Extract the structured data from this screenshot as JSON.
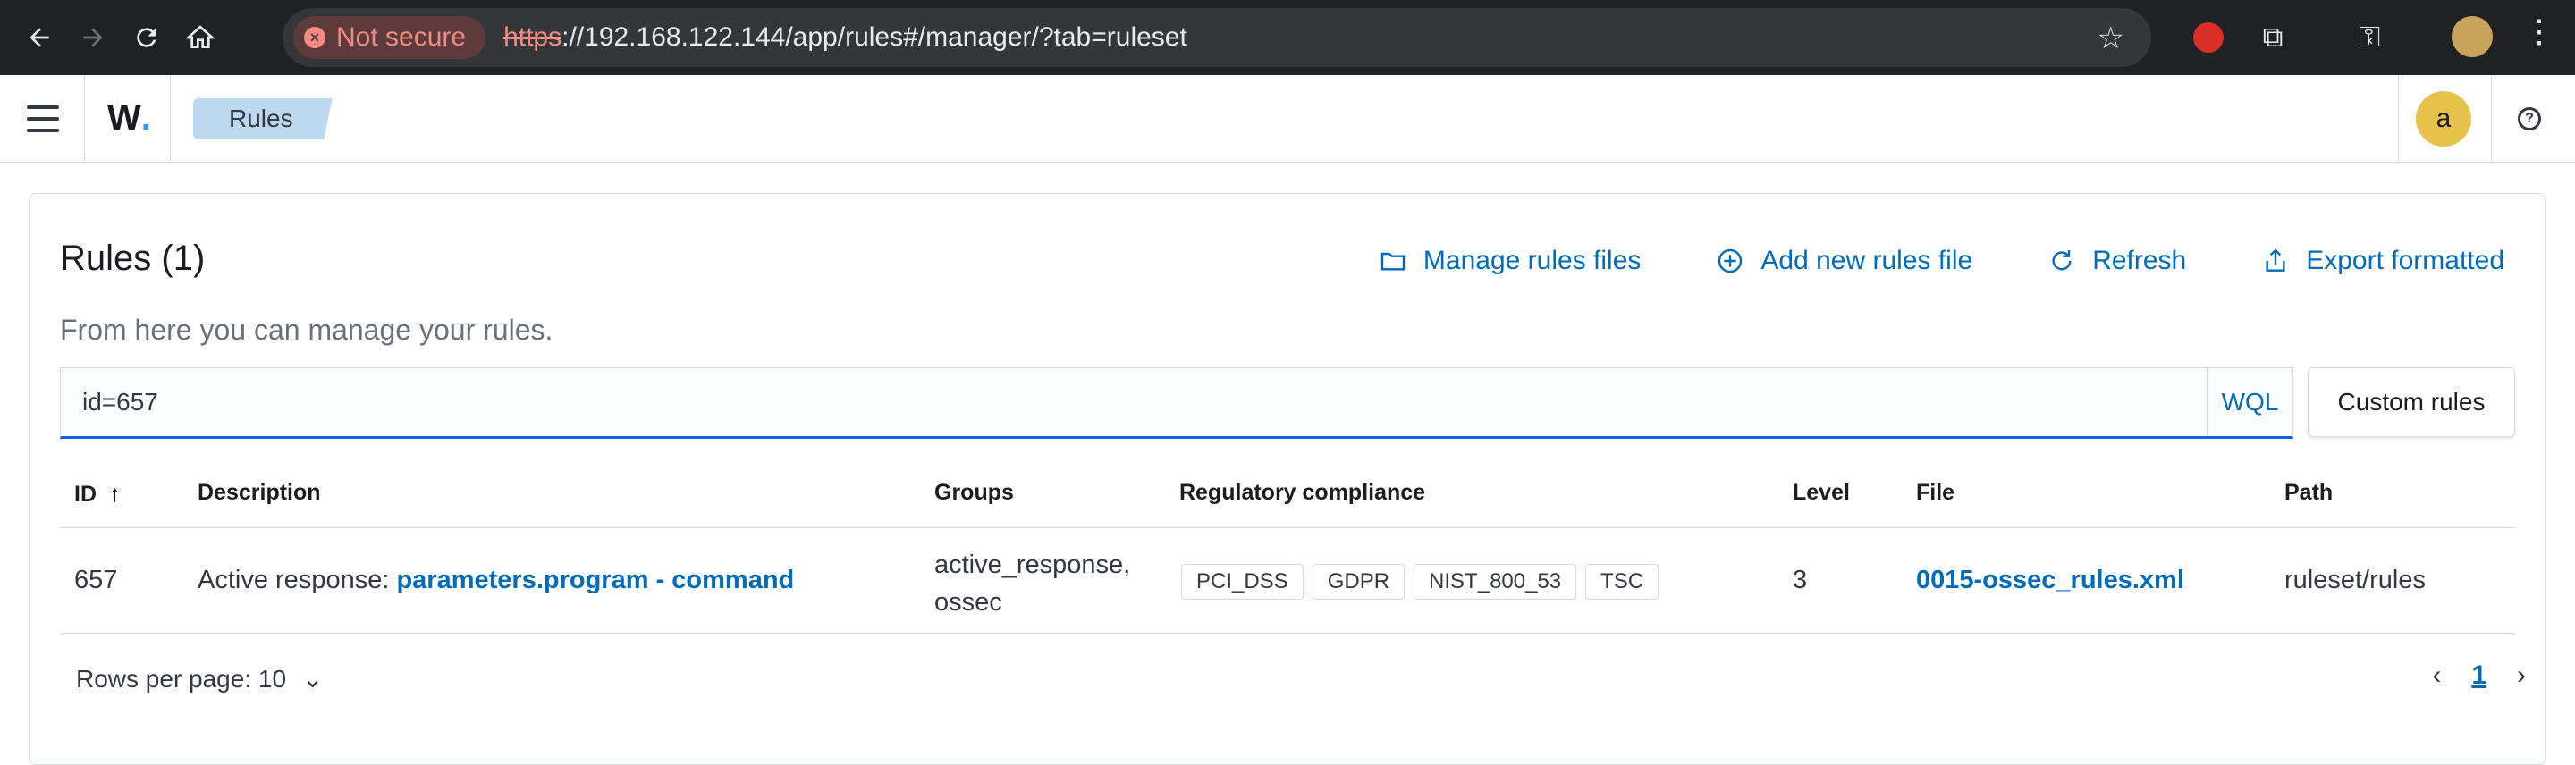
{
  "browser": {
    "security_label": "Not secure",
    "url_scheme": "https",
    "url_rest": "://192.168.122.144/app/rules#/manager/?tab=ruleset"
  },
  "header": {
    "logo": "W",
    "breadcrumb": "Rules",
    "avatar_initial": "a"
  },
  "page": {
    "title": "Rules (1)",
    "subtitle": "From here you can manage your rules.",
    "actions": {
      "manage": "Manage rules files",
      "add": "Add new rules file",
      "refresh": "Refresh",
      "export": "Export formatted"
    },
    "search": {
      "value": "id=657",
      "wql": "WQL"
    },
    "custom_rules_label": "Custom rules"
  },
  "table": {
    "columns": {
      "id": "ID",
      "description": "Description",
      "groups": "Groups",
      "compliance": "Regulatory compliance",
      "level": "Level",
      "file": "File",
      "path": "Path"
    },
    "rows": [
      {
        "id": "657",
        "description_prefix": "Active response: ",
        "description_field1": "parameters.program",
        "description_sep": " - ",
        "description_field2": "command",
        "groups_line1": "active_response,",
        "groups_line2": "ossec",
        "compliance": [
          "PCI_DSS",
          "GDPR",
          "NIST_800_53",
          "TSC"
        ],
        "level": "3",
        "file": "0015-ossec_rules.xml",
        "path": "ruleset/rules"
      }
    ]
  },
  "footer": {
    "rows_per_page": "Rows per page: 10",
    "current_page": "1"
  }
}
